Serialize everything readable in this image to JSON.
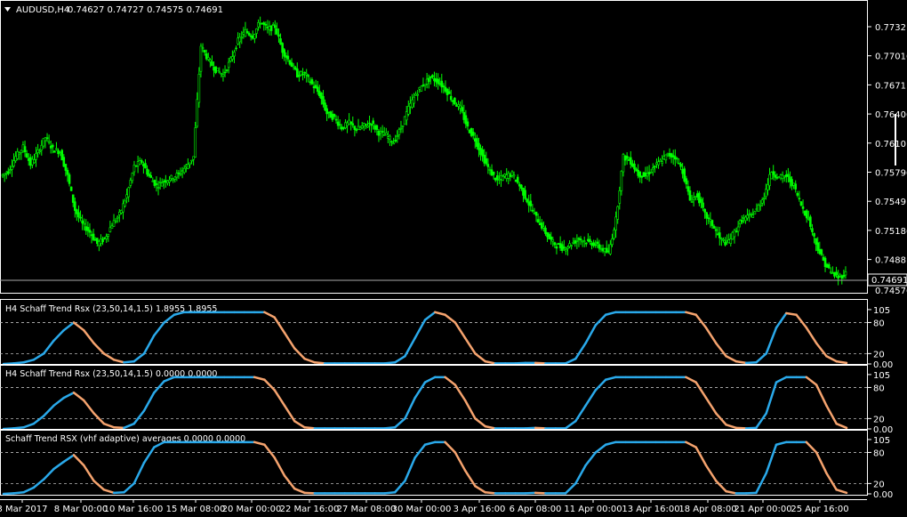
{
  "chart_header": {
    "arrow": "dropdown-triangle-icon",
    "symbol": "AUDUSD,H4",
    "ohlc": "0.74627 0.74727 0.74575 0.74691"
  },
  "colors": {
    "background": "#000000",
    "candle": "#00ff00",
    "axis": "#ffffff",
    "rising": "#2aa9ea",
    "falling": "#f5a36e",
    "level": "#bbbbbb"
  },
  "price_axis": {
    "ticks": [
      "0.77321",
      "0.77016",
      "0.76711",
      "0.76406",
      "0.76101",
      "0.75796",
      "0.75491",
      "0.75186",
      "0.74881",
      "0.74576"
    ],
    "current_price": "0.74691",
    "range": [
      0.745,
      0.7745
    ]
  },
  "time_axis": {
    "labels": [
      "3 Mar 2017",
      "8 Mar 00:00",
      "10 Mar 16:00",
      "15 Mar 08:00",
      "20 Mar 00:00",
      "22 Mar 16:00",
      "27 Mar 08:00",
      "30 Mar 00:00",
      "3 Apr 16:00",
      "6 Apr 08:00",
      "11 Apr 00:00",
      "13 Apr 16:00",
      "18 Apr 08:00",
      "21 Apr 00:00",
      "25 Apr 16:00"
    ]
  },
  "panels": [
    {
      "title": "H4 Schaff Trend Rsx (23,50,14,1.5) 1.8955 1.8955",
      "ticks": [
        "105",
        "80",
        "20",
        "0.00"
      ]
    },
    {
      "title": "H4 Schaff Trend Rsx (23,50,14,1.5) 0.0000 0.0000",
      "ticks": [
        "105",
        "80",
        "20",
        "0.00"
      ]
    },
    {
      "title": "Schaff Trend RSX (vhf adaptive) averages 0.0000 0.0000",
      "ticks": [
        "105",
        "80",
        "20",
        "0.00"
      ]
    }
  ],
  "chart_data": {
    "type": "line",
    "main_price_path": [
      [
        0,
        0.757
      ],
      [
        1,
        0.7575
      ],
      [
        2,
        0.759
      ],
      [
        3,
        0.76
      ],
      [
        4,
        0.7582
      ],
      [
        5,
        0.7595
      ],
      [
        6,
        0.761
      ],
      [
        7,
        0.7598
      ],
      [
        8,
        0.7595
      ],
      [
        9,
        0.757
      ],
      [
        10,
        0.7535
      ],
      [
        11,
        0.752
      ],
      [
        12,
        0.7512
      ],
      [
        13,
        0.75
      ],
      [
        14,
        0.7505
      ],
      [
        15,
        0.752
      ],
      [
        16,
        0.753
      ],
      [
        17,
        0.755
      ],
      [
        18,
        0.758
      ],
      [
        19,
        0.7585
      ],
      [
        20,
        0.757
      ],
      [
        21,
        0.756
      ],
      [
        22,
        0.7565
      ],
      [
        23,
        0.7568
      ],
      [
        24,
        0.7572
      ],
      [
        25,
        0.758
      ],
      [
        26,
        0.759
      ],
      [
        27,
        0.7705
      ],
      [
        28,
        0.769
      ],
      [
        29,
        0.768
      ],
      [
        30,
        0.7675
      ],
      [
        31,
        0.769
      ],
      [
        32,
        0.771
      ],
      [
        33,
        0.772
      ],
      [
        34,
        0.7715
      ],
      [
        35,
        0.773
      ],
      [
        36,
        0.7722
      ],
      [
        37,
        0.7725
      ],
      [
        38,
        0.77
      ],
      [
        39,
        0.7688
      ],
      [
        40,
        0.7675
      ],
      [
        41,
        0.7676
      ],
      [
        42,
        0.7665
      ],
      [
        43,
        0.7655
      ],
      [
        44,
        0.7635
      ],
      [
        45,
        0.763
      ],
      [
        46,
        0.762
      ],
      [
        47,
        0.7625
      ],
      [
        48,
        0.7618
      ],
      [
        49,
        0.7622
      ],
      [
        50,
        0.7625
      ],
      [
        51,
        0.7615
      ],
      [
        52,
        0.7612
      ],
      [
        53,
        0.7605
      ],
      [
        54,
        0.762
      ],
      [
        55,
        0.764
      ],
      [
        56,
        0.7655
      ],
      [
        57,
        0.7665
      ],
      [
        58,
        0.7672
      ],
      [
        59,
        0.7668
      ],
      [
        60,
        0.766
      ],
      [
        61,
        0.7648
      ],
      [
        62,
        0.764
      ],
      [
        63,
        0.762
      ],
      [
        64,
        0.7608
      ],
      [
        65,
        0.759
      ],
      [
        66,
        0.7575
      ],
      [
        67,
        0.7565
      ],
      [
        68,
        0.757
      ],
      [
        69,
        0.7572
      ],
      [
        70,
        0.756
      ],
      [
        71,
        0.7545
      ],
      [
        72,
        0.753
      ],
      [
        73,
        0.7518
      ],
      [
        74,
        0.7505
      ],
      [
        75,
        0.7498
      ],
      [
        76,
        0.7495
      ],
      [
        77,
        0.75
      ],
      [
        78,
        0.7505
      ],
      [
        79,
        0.7502
      ],
      [
        80,
        0.75
      ],
      [
        81,
        0.7495
      ],
      [
        82,
        0.749
      ],
      [
        83,
        0.7525
      ],
      [
        84,
        0.759
      ],
      [
        85,
        0.7585
      ],
      [
        86,
        0.7572
      ],
      [
        87,
        0.757
      ],
      [
        88,
        0.7578
      ],
      [
        89,
        0.7585
      ],
      [
        90,
        0.7592
      ],
      [
        91,
        0.759
      ],
      [
        92,
        0.7575
      ],
      [
        93,
        0.7545
      ],
      [
        94,
        0.755
      ],
      [
        95,
        0.753
      ],
      [
        96,
        0.752
      ],
      [
        97,
        0.7505
      ],
      [
        98,
        0.75
      ],
      [
        99,
        0.7512
      ],
      [
        100,
        0.7525
      ],
      [
        101,
        0.7528
      ],
      [
        102,
        0.7535
      ],
      [
        103,
        0.755
      ],
      [
        104,
        0.7575
      ],
      [
        105,
        0.7568
      ],
      [
        106,
        0.757
      ],
      [
        107,
        0.756
      ],
      [
        108,
        0.754
      ],
      [
        109,
        0.7525
      ],
      [
        110,
        0.75
      ],
      [
        111,
        0.7482
      ],
      [
        112,
        0.747
      ],
      [
        113,
        0.7465
      ],
      [
        114,
        0.7469
      ]
    ],
    "indicator_series": [
      {
        "values": [
          0,
          1,
          3,
          8,
          20,
          45,
          65,
          80,
          65,
          40,
          20,
          8,
          3,
          5,
          20,
          55,
          80,
          95,
          100,
          100,
          100,
          100,
          100,
          100,
          100,
          100,
          100,
          90,
          60,
          30,
          10,
          3,
          1,
          1,
          1,
          1,
          1,
          1,
          1,
          3,
          15,
          50,
          85,
          100,
          95,
          80,
          50,
          20,
          5,
          1,
          1,
          1,
          2,
          2,
          1,
          1,
          1,
          10,
          40,
          75,
          95,
          100,
          100,
          100,
          100,
          100,
          100,
          100,
          100,
          95,
          70,
          40,
          15,
          5,
          2,
          3,
          20,
          70,
          98,
          95,
          70,
          40,
          15,
          5,
          2
        ]
      },
      {
        "values": [
          0,
          1,
          3,
          10,
          25,
          45,
          60,
          70,
          55,
          30,
          10,
          3,
          2,
          10,
          35,
          70,
          92,
          100,
          100,
          100,
          100,
          100,
          100,
          100,
          100,
          100,
          95,
          75,
          45,
          15,
          3,
          1,
          1,
          1,
          1,
          1,
          1,
          1,
          1,
          3,
          20,
          60,
          90,
          100,
          100,
          85,
          55,
          20,
          5,
          1,
          1,
          1,
          1,
          2,
          1,
          1,
          1,
          15,
          45,
          75,
          95,
          100,
          100,
          100,
          100,
          100,
          100,
          100,
          100,
          90,
          60,
          30,
          8,
          2,
          1,
          2,
          30,
          90,
          100,
          100,
          100,
          85,
          45,
          10,
          2
        ]
      },
      {
        "values": [
          0,
          1,
          3,
          12,
          28,
          48,
          62,
          75,
          55,
          25,
          8,
          2,
          3,
          20,
          60,
          90,
          100,
          100,
          100,
          100,
          100,
          100,
          100,
          100,
          100,
          100,
          95,
          70,
          35,
          10,
          2,
          1,
          1,
          1,
          1,
          1,
          1,
          1,
          1,
          3,
          25,
          70,
          95,
          100,
          100,
          80,
          45,
          15,
          3,
          1,
          1,
          1,
          1,
          2,
          1,
          1,
          1,
          20,
          55,
          80,
          95,
          100,
          100,
          100,
          100,
          100,
          100,
          100,
          100,
          90,
          55,
          25,
          5,
          1,
          1,
          2,
          40,
          95,
          100,
          100,
          100,
          80,
          40,
          8,
          2
        ]
      }
    ]
  }
}
